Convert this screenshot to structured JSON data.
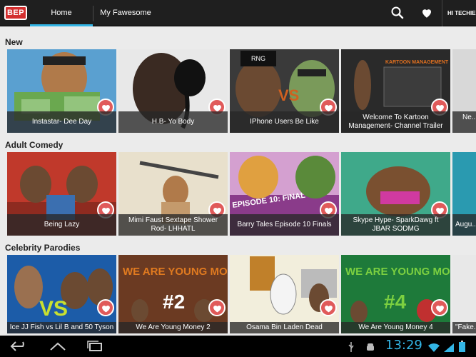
{
  "app": {
    "logo": "BEP"
  },
  "tabs": [
    {
      "label": "Home",
      "active": true
    },
    {
      "label": "My Fawesome",
      "active": false
    }
  ],
  "user": {
    "greeting": "HI TECHIE"
  },
  "colors": {
    "accent": "#33b5e5",
    "heart": "#e05a5a",
    "actionbar": "#1f1f1f"
  },
  "sections": [
    {
      "title": "New",
      "videos": [
        {
          "title": "Instastar- Dee Day"
        },
        {
          "title": "H.B- Yo Body"
        },
        {
          "title": "IPhone Users Be Like"
        },
        {
          "title": "Welcome To Kartoon Management- Channel Trailer"
        },
        {
          "title": "Ne..."
        }
      ]
    },
    {
      "title": "Adult Comedy",
      "videos": [
        {
          "title": "Being Lazy"
        },
        {
          "title": "Mimi Faust Sextape Shower Rod- LHHATL"
        },
        {
          "title": "Barry Tales Episode 10 Finals"
        },
        {
          "title": "Skype Hype- SparkDawg ft JBAR SODMG"
        },
        {
          "title": "Augu..."
        }
      ]
    },
    {
      "title": "Celebrity Parodies",
      "videos": [
        {
          "title": "Ice JJ Fish vs Lil B and 50 Tyson"
        },
        {
          "title": "We Are Young Money 2"
        },
        {
          "title": "Osama Bin Laden Dead"
        },
        {
          "title": "We Are Young Money 4"
        },
        {
          "title": "\"Fake..."
        }
      ]
    }
  ],
  "thumb_texts": {
    "young_money": "WE ARE YOUNG MONEY",
    "num2": "#2",
    "num4": "#4",
    "vs": "VS",
    "kartoon": "KARTOON MANAGEMENT",
    "episode": "EPISODE 10: FINAL",
    "rng": "RNG"
  },
  "status": {
    "time": "13:29"
  }
}
